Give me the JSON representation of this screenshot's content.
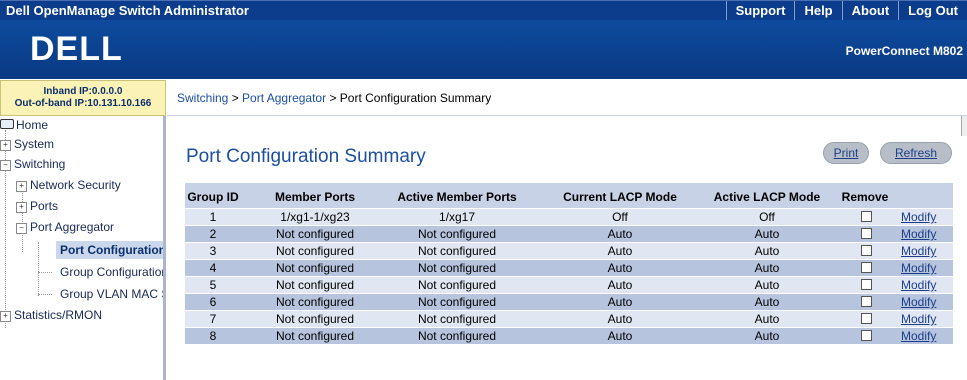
{
  "app": {
    "title": "Dell OpenManage Switch Administrator",
    "links": [
      "Support",
      "Help",
      "About",
      "Log Out"
    ],
    "product": "PowerConnect M802",
    "logo_text": "DELL"
  },
  "ip": {
    "inband": "Inband IP:0.0.0.0",
    "outofband": "Out-of-band IP:10.131.10.166"
  },
  "breadcrumb": {
    "part1": "Switching",
    "sep": " > ",
    "part2": "Port Aggregator",
    "part3": "Port Configuration Summary"
  },
  "nav": {
    "home": "Home",
    "system": "System",
    "switching": "Switching",
    "network_security": "Network Security",
    "ports": "Ports",
    "port_aggregator": "Port Aggregator",
    "port_configuration": "Port Configuration",
    "group_configuration": "Group Configuration",
    "group_vlan_mac": "Group VLAN MAC S",
    "statistics": "Statistics/RMON"
  },
  "page": {
    "title": "Port Configuration Summary",
    "print": "Print",
    "refresh": "Refresh"
  },
  "table": {
    "headers": [
      "Group ID",
      "Member Ports",
      "Active Member Ports",
      "Current LACP Mode",
      "Active LACP Mode",
      "Remove"
    ],
    "modify_label": "Modify",
    "rows": [
      {
        "id": "1",
        "member": "1/xg1-1/xg23",
        "active_member": "1/xg17",
        "current": "Off",
        "active": "Off"
      },
      {
        "id": "2",
        "member": "Not configured",
        "active_member": "Not configured",
        "current": "Auto",
        "active": "Auto"
      },
      {
        "id": "3",
        "member": "Not configured",
        "active_member": "Not configured",
        "current": "Auto",
        "active": "Auto"
      },
      {
        "id": "4",
        "member": "Not configured",
        "active_member": "Not configured",
        "current": "Auto",
        "active": "Auto"
      },
      {
        "id": "5",
        "member": "Not configured",
        "active_member": "Not configured",
        "current": "Auto",
        "active": "Auto"
      },
      {
        "id": "6",
        "member": "Not configured",
        "active_member": "Not configured",
        "current": "Auto",
        "active": "Auto"
      },
      {
        "id": "7",
        "member": "Not configured",
        "active_member": "Not configured",
        "current": "Auto",
        "active": "Auto"
      },
      {
        "id": "8",
        "member": "Not configured",
        "active_member": "Not configured",
        "current": "Auto",
        "active": "Auto"
      }
    ]
  }
}
